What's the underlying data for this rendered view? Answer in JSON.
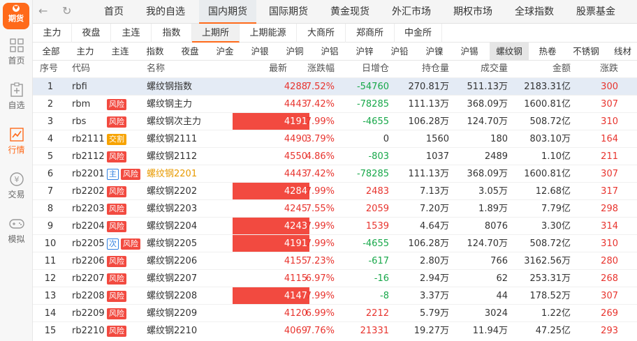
{
  "app": {
    "logo_text": "期货",
    "logo_mark": "♥"
  },
  "sidebar": {
    "items": [
      {
        "label": "首页",
        "icon": "home-grid-icon"
      },
      {
        "label": "自选",
        "icon": "clipboard-plus-icon"
      },
      {
        "label": "行情",
        "icon": "chart-line-icon",
        "active": true
      },
      {
        "label": "交易",
        "icon": "yen-coin-icon"
      },
      {
        "label": "模拟",
        "icon": "gamepad-icon"
      }
    ]
  },
  "topnav": {
    "back": "←",
    "refresh": "↻",
    "tabs": [
      "首页",
      "我的自选",
      "国内期货",
      "国际期货",
      "黄金现货",
      "外汇市场",
      "期权市场",
      "全球指数",
      "股票基金"
    ],
    "active_tab": "国内期货"
  },
  "exchange_tabs": {
    "items": [
      "主力",
      "夜盘",
      "主连",
      "指数",
      "上期所",
      "上期能源",
      "大商所",
      "郑商所",
      "中金所"
    ],
    "active": "上期所"
  },
  "product_tabs": {
    "items": [
      "全部",
      "主力",
      "主连",
      "指数",
      "夜盘",
      "沪金",
      "沪银",
      "沪铜",
      "沪铝",
      "沪锌",
      "沪铅",
      "沪镍",
      "沪锡",
      "螺纹钢",
      "热卷",
      "不锈钢",
      "线材"
    ],
    "active": "螺纹钢"
  },
  "table": {
    "headers": [
      "序号",
      "代码",
      "名称",
      "最新",
      "涨跌幅",
      "日增仓",
      "持仓量",
      "成交量",
      "金额",
      "涨跌"
    ],
    "rows": [
      {
        "no": "1",
        "code": "rbfi",
        "badges": [],
        "name": "螺纹钢指数",
        "last": "4288",
        "pct": "7.52%",
        "inc": "-54760",
        "oi": "270.81万",
        "vol": "511.13万",
        "amt": "2183.31亿",
        "chg": "300"
      },
      {
        "no": "2",
        "code": "rbm",
        "badges": [
          "风险"
        ],
        "name": "螺纹钢主力",
        "last": "4443",
        "pct": "7.42%",
        "inc": "-78285",
        "oi": "111.13万",
        "vol": "368.09万",
        "amt": "1600.81亿",
        "chg": "307"
      },
      {
        "no": "3",
        "code": "rbs",
        "badges": [
          "风险"
        ],
        "name": "螺纹钢次主力",
        "last": "4191",
        "pct": "7.99%",
        "inc": "-4655",
        "oi": "106.28万",
        "vol": "124.70万",
        "amt": "508.72亿",
        "chg": "310"
      },
      {
        "no": "4",
        "code": "rb2111",
        "badges": [
          "交割"
        ],
        "name": "螺纹钢2111",
        "last": "4490",
        "pct": "3.79%",
        "inc": "0",
        "oi": "1560",
        "vol": "180",
        "amt": "803.10万",
        "chg": "164"
      },
      {
        "no": "5",
        "code": "rb2112",
        "badges": [
          "风险"
        ],
        "name": "螺纹钢2112",
        "last": "4550",
        "pct": "4.86%",
        "inc": "-803",
        "oi": "1037",
        "vol": "2489",
        "amt": "1.10亿",
        "chg": "211"
      },
      {
        "no": "6",
        "code": "rb2201",
        "badges": [
          "主",
          "风险"
        ],
        "name": "螺纹钢2201",
        "last": "4443",
        "pct": "7.42%",
        "inc": "-78285",
        "oi": "111.13万",
        "vol": "368.09万",
        "amt": "1600.81亿",
        "chg": "307"
      },
      {
        "no": "7",
        "code": "rb2202",
        "badges": [
          "风险"
        ],
        "name": "螺纹钢2202",
        "last": "4284",
        "pct": "7.99%",
        "inc": "2483",
        "oi": "7.13万",
        "vol": "3.05万",
        "amt": "12.68亿",
        "chg": "317"
      },
      {
        "no": "8",
        "code": "rb2203",
        "badges": [
          "风险"
        ],
        "name": "螺纹钢2203",
        "last": "4245",
        "pct": "7.55%",
        "inc": "2059",
        "oi": "7.20万",
        "vol": "1.89万",
        "amt": "7.79亿",
        "chg": "298"
      },
      {
        "no": "9",
        "code": "rb2204",
        "badges": [
          "风险"
        ],
        "name": "螺纹钢2204",
        "last": "4243",
        "pct": "7.99%",
        "inc": "1539",
        "oi": "4.64万",
        "vol": "8076",
        "amt": "3.30亿",
        "chg": "314"
      },
      {
        "no": "10",
        "code": "rb2205",
        "badges": [
          "次",
          "风险"
        ],
        "name": "螺纹钢2205",
        "last": "4191",
        "pct": "7.99%",
        "inc": "-4655",
        "oi": "106.28万",
        "vol": "124.70万",
        "amt": "508.72亿",
        "chg": "310"
      },
      {
        "no": "11",
        "code": "rb2206",
        "badges": [
          "风险"
        ],
        "name": "螺纹钢2206",
        "last": "4155",
        "pct": "7.23%",
        "inc": "-617",
        "oi": "2.80万",
        "vol": "766",
        "amt": "3162.56万",
        "chg": "280"
      },
      {
        "no": "12",
        "code": "rb2207",
        "badges": [
          "风险"
        ],
        "name": "螺纹钢2207",
        "last": "4115",
        "pct": "6.97%",
        "inc": "-16",
        "oi": "2.94万",
        "vol": "62",
        "amt": "253.31万",
        "chg": "268"
      },
      {
        "no": "13",
        "code": "rb2208",
        "badges": [
          "风险"
        ],
        "name": "螺纹钢2208",
        "last": "4147",
        "pct": "7.99%",
        "inc": "-8",
        "oi": "3.37万",
        "vol": "44",
        "amt": "178.52万",
        "chg": "307"
      },
      {
        "no": "14",
        "code": "rb2209",
        "badges": [
          "风险"
        ],
        "name": "螺纹钢2209",
        "last": "4120",
        "pct": "6.99%",
        "inc": "2212",
        "oi": "5.79万",
        "vol": "3024",
        "amt": "1.22亿",
        "chg": "269"
      },
      {
        "no": "15",
        "code": "rb2210",
        "badges": [
          "风险"
        ],
        "name": "螺纹钢2210",
        "last": "4069",
        "pct": "7.76%",
        "inc": "21331",
        "oi": "19.27万",
        "vol": "11.94万",
        "amt": "47.25亿",
        "chg": "293"
      }
    ]
  },
  "colors": {
    "up": "#e8342e",
    "down": "#18a84a",
    "accent": "#ff6a1a",
    "limit_up_bg": "#f24a40",
    "selected_row": "#e4ebf5"
  }
}
